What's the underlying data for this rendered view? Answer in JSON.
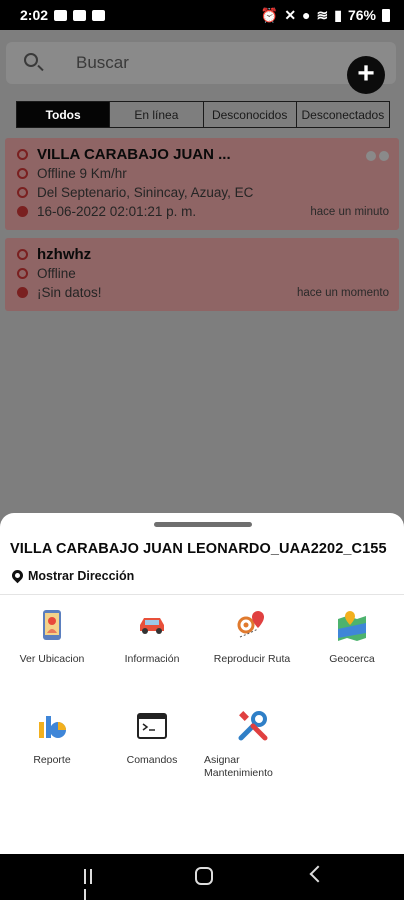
{
  "status_bar": {
    "time": "2:02",
    "battery": "76%"
  },
  "search": {
    "placeholder": "Buscar"
  },
  "add_button": {
    "label": "+"
  },
  "tabs": [
    {
      "label": "Todos",
      "active": true
    },
    {
      "label": "En línea",
      "active": false
    },
    {
      "label": "Desconocidos",
      "active": false
    },
    {
      "label": "Desconectados",
      "active": false
    }
  ],
  "devices": [
    {
      "name": "VILLA CARABAJO JUAN ...",
      "status": "Offline 9 Km/hr",
      "address": "Del Septenario, Sinincay, Azuay, EC",
      "timestamp": "16-06-2022 02:01:21 p. m.",
      "ago": "hace un minuto"
    },
    {
      "name": "hzhwhz",
      "status": "Offline",
      "nodata": "¡Sin datos!",
      "ago": "hace un momento"
    }
  ],
  "sheet": {
    "title": "VILLA CARABAJO JUAN LEONARDO_UAA2202_C155",
    "show_address": "Mostrar Dirección",
    "actions": [
      {
        "label": "Ver Ubicacion",
        "icon": "phone-location-icon"
      },
      {
        "label": "Información",
        "icon": "car-icon"
      },
      {
        "label": "Reproducir Ruta",
        "icon": "route-pins-icon"
      },
      {
        "label": "Geocerca",
        "icon": "map-geofence-icon"
      },
      {
        "label": "Reporte",
        "icon": "report-chart-icon"
      },
      {
        "label": "Comandos",
        "icon": "terminal-icon"
      },
      {
        "label": "Asignar Mantenimiento",
        "icon": "tools-icon"
      }
    ]
  },
  "colors": {
    "card_offline": "#8f6565",
    "accent_dark": "#050505",
    "offline_red": "#7a2020"
  }
}
